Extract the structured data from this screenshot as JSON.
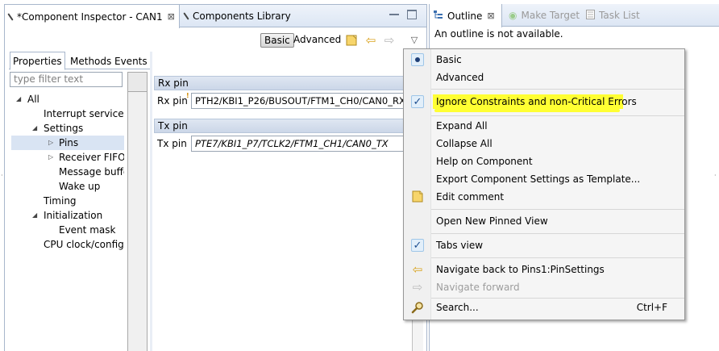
{
  "editor": {
    "tabs": [
      {
        "label": "*Component Inspector - CAN1",
        "close": "⊠"
      },
      {
        "label": "Components Library"
      }
    ],
    "toolbar": {
      "basic_label": "Basic",
      "advanced_label": "Advanced",
      "back_glyph": "⇦",
      "forward_glyph": "⇨",
      "menu_glyph": "▽"
    },
    "subtabs": [
      "Properties",
      "Methods",
      "Events"
    ],
    "filter_placeholder": "type filter text",
    "tree": [
      {
        "label": "All",
        "twisty": "◢"
      },
      {
        "label": "Interrupt service"
      },
      {
        "label": "Settings",
        "twisty": "◢"
      },
      {
        "label": "Pins",
        "twisty": "▷",
        "selected": true
      },
      {
        "label": "Receiver FIFO",
        "twisty": "▷"
      },
      {
        "label": "Message buffe"
      },
      {
        "label": "Wake up"
      },
      {
        "label": "Timing"
      },
      {
        "label": "Initialization",
        "twisty": "◢"
      },
      {
        "label": "Event mask"
      },
      {
        "label": "CPU clock/config"
      }
    ],
    "groups": [
      {
        "header": "Rx pin",
        "label": "Rx pin",
        "badge": "!",
        "value": "PTH2/KBI1_P26/BUSOUT/FTM1_CH0/CAN0_RX"
      },
      {
        "header": "Tx pin",
        "label": "Tx pin",
        "value": "PTE7/KBI1_P7/TCLK2/FTM1_CH1/CAN0_TX"
      }
    ]
  },
  "outline": {
    "tabs": [
      {
        "label": "Outline",
        "close": "⊠"
      },
      {
        "label": "Make Target"
      },
      {
        "label": "Task List"
      }
    ],
    "message": "An outline is not available."
  },
  "context_menu": {
    "items": [
      {
        "label": "Basic",
        "icon": "radio-selected-icon"
      },
      {
        "label": "Advanced"
      },
      {
        "label": "Ignore Constraints and non-Critical Errors",
        "icon": "checkmark-icon",
        "glyph": "✓",
        "highlight_color": "#ffff33"
      },
      {
        "label": "Expand All"
      },
      {
        "label": "Collapse All"
      },
      {
        "label": "Help on Component"
      },
      {
        "label": "Export Component Settings as Template..."
      },
      {
        "label": "Edit comment",
        "icon": "note-icon"
      },
      {
        "label": "Open New Pinned View"
      },
      {
        "label": "Tabs view",
        "icon": "checkmark-icon",
        "glyph": "✓"
      },
      {
        "label": "Navigate back to Pins1:PinSettings",
        "icon": "back-arrow-icon",
        "glyph": "⇦"
      },
      {
        "label": "Navigate forward",
        "icon": "forward-arrow-icon",
        "glyph": "⇨",
        "disabled": true
      },
      {
        "label": "Search...",
        "icon": "search-icon",
        "shortcut": "Ctrl+F"
      }
    ]
  },
  "colors": {
    "highlight": "#ffff33",
    "tab_gradient_top": "#eef3fa",
    "view_border": "#a8b7cc",
    "selection": "#d9e4f3"
  }
}
